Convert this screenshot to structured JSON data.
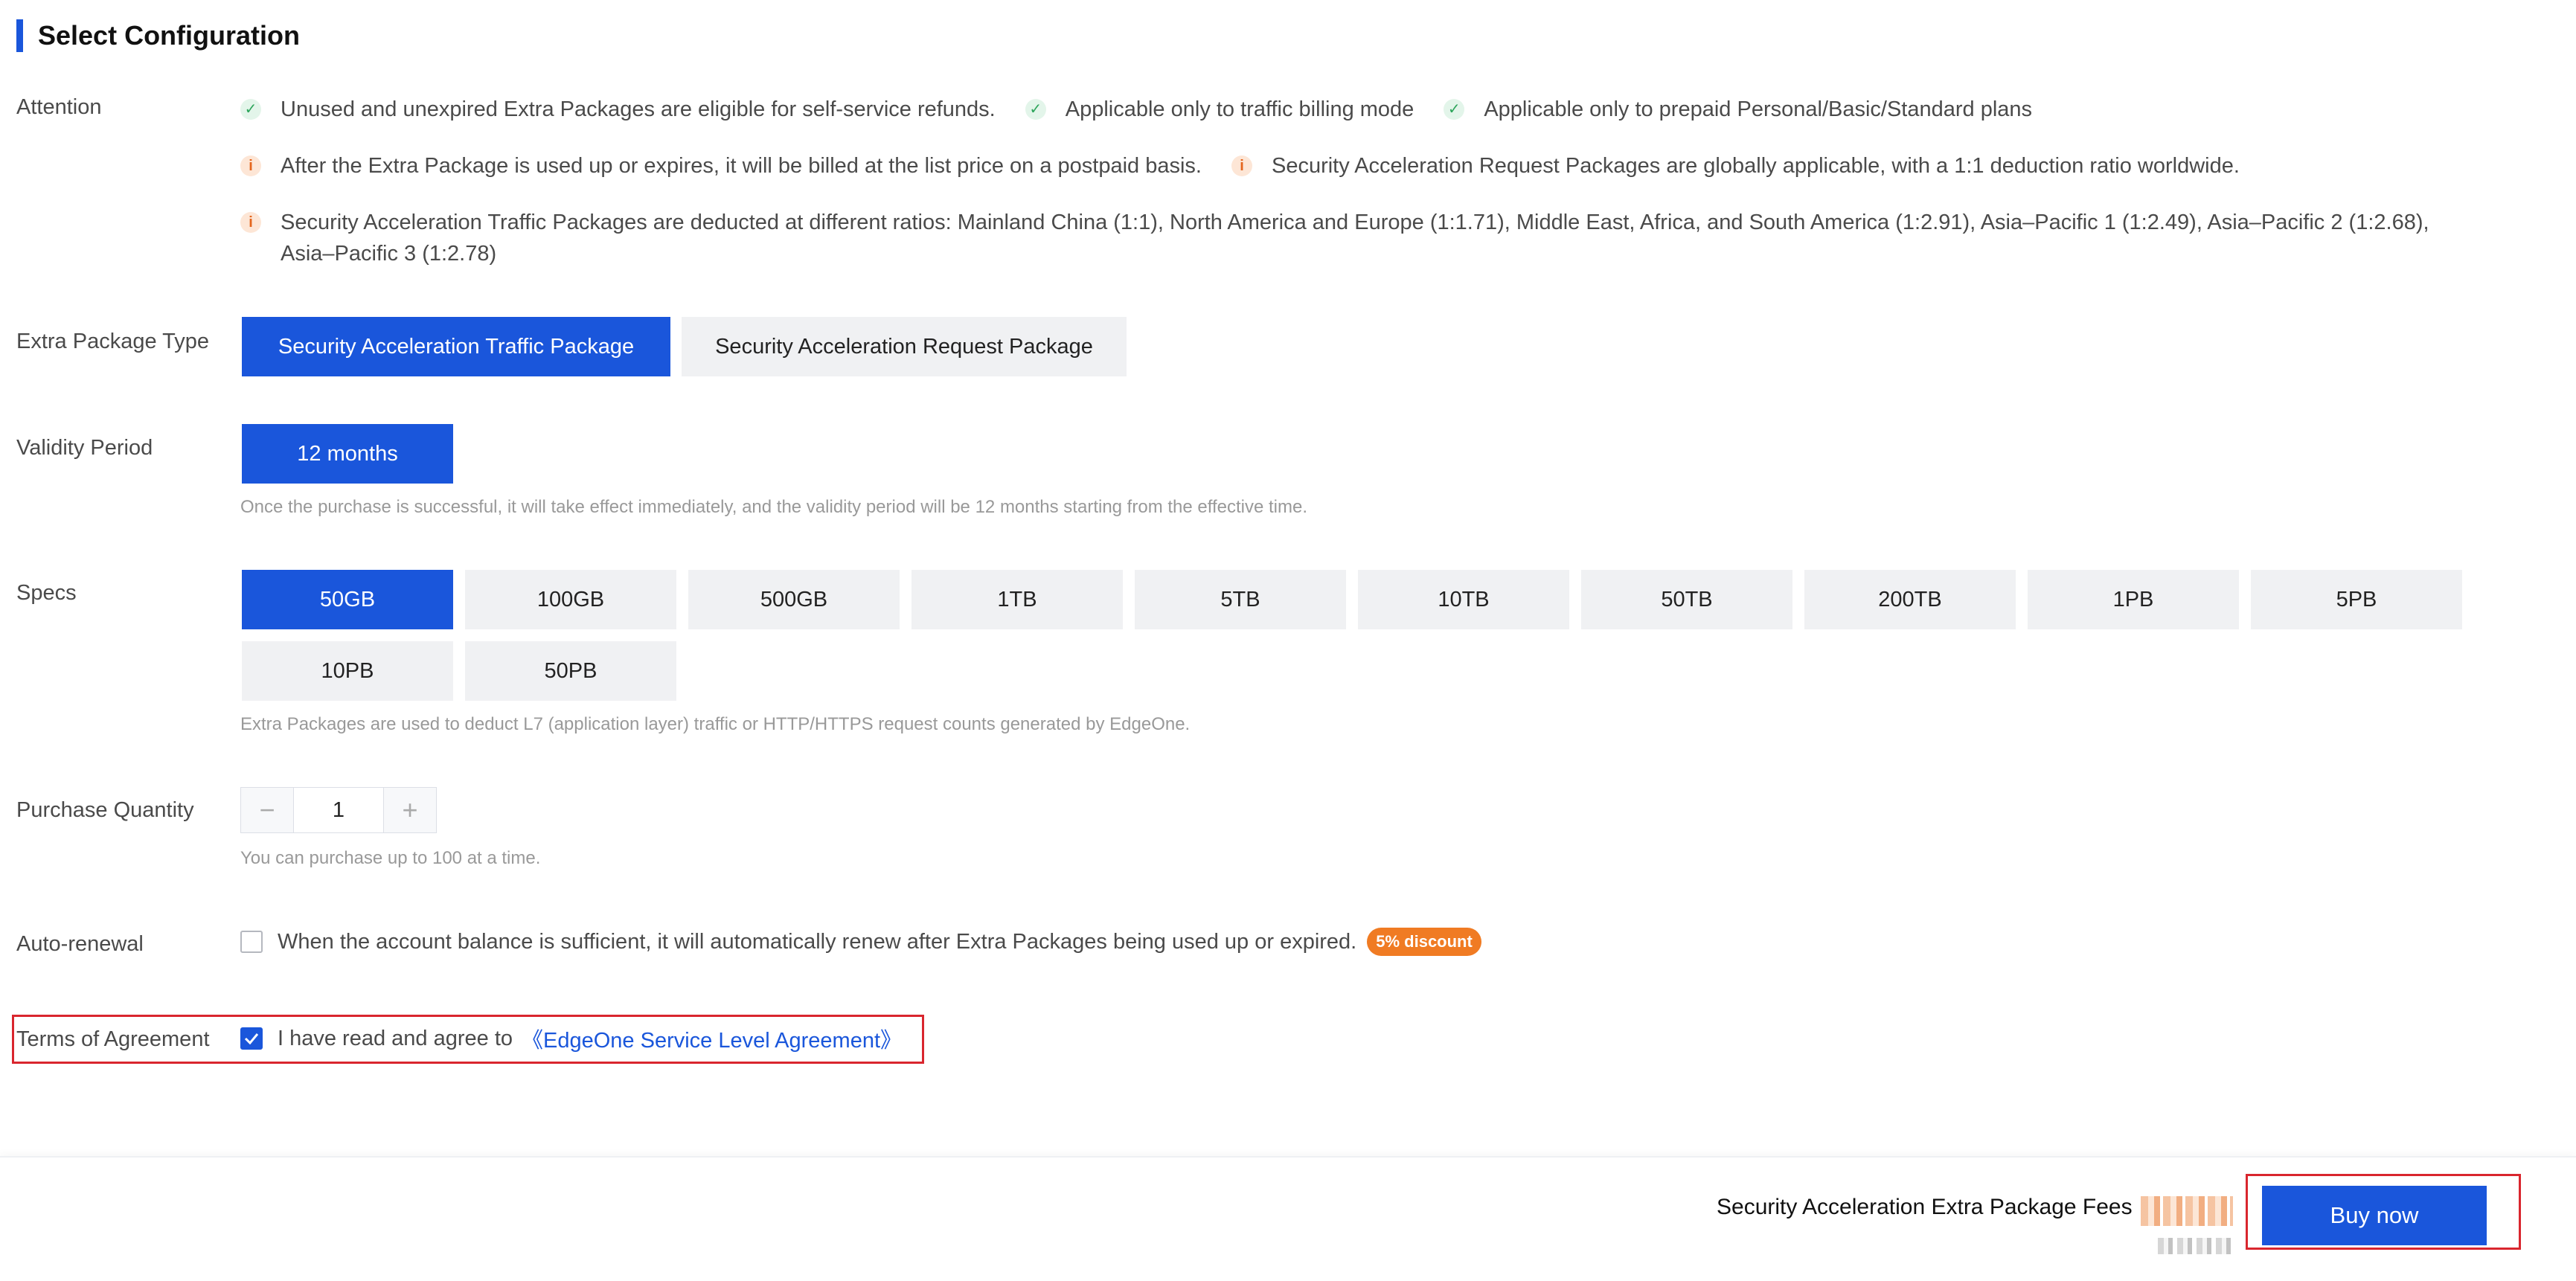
{
  "title": "Select Configuration",
  "attention": {
    "label": "Attention",
    "row1": [
      {
        "icon": "check-icon",
        "text": "Unused and unexpired Extra Packages are eligible for self-service refunds."
      },
      {
        "icon": "check-icon",
        "text": "Applicable only to traffic billing mode"
      },
      {
        "icon": "check-icon",
        "text": "Applicable only to prepaid Personal/Basic/Standard plans"
      }
    ],
    "row2": [
      {
        "icon": "info-icon",
        "text": "After the Extra Package is used up or expires, it will be billed at the list price on a postpaid basis."
      },
      {
        "icon": "info-icon",
        "text": "Security Acceleration Request Packages are globally applicable, with a 1:1 deduction ratio worldwide."
      }
    ],
    "row3": {
      "icon": "info-icon",
      "text": "Security Acceleration Traffic Packages are deducted at different ratios: Mainland China (1:1), North America and Europe (1:1.71), Middle East, Africa, and South America (1:2.91), Asia–Pacific 1 (1:2.49), Asia–Pacific 2 (1:2.68), Asia–Pacific 3 (1:2.78)"
    }
  },
  "package_type": {
    "label": "Extra Package Type",
    "options": [
      "Security Acceleration Traffic Package",
      "Security Acceleration Request Package"
    ],
    "selected": "Security Acceleration Traffic Package"
  },
  "validity": {
    "label": "Validity Period",
    "options": [
      "12 months"
    ],
    "selected": "12 months",
    "hint": "Once the purchase is successful, it will take effect immediately, and the validity period will be 12 months starting from the effective time."
  },
  "specs": {
    "label": "Specs",
    "options": [
      "50GB",
      "100GB",
      "500GB",
      "1TB",
      "5TB",
      "10TB",
      "50TB",
      "200TB",
      "1PB",
      "5PB",
      "10PB",
      "50PB"
    ],
    "selected": "50GB",
    "hint": "Extra Packages are used to deduct L7 (application layer) traffic or HTTP/HTTPS request counts generated by EdgeOne."
  },
  "quantity": {
    "label": "Purchase Quantity",
    "value": "1",
    "minus": "−",
    "plus": "+",
    "hint": "You can purchase up to 100 at a time."
  },
  "auto_renewal": {
    "label": "Auto-renewal",
    "checked": false,
    "text": "When the account balance is sufficient, it will automatically renew after Extra Packages being used up or expired.",
    "badge": "5% discount"
  },
  "terms": {
    "label": "Terms of Agreement",
    "checked": true,
    "text": "I have read and agree to",
    "link": "《EdgeOne Service Level Agreement》"
  },
  "footer": {
    "fee_label": "Security Acceleration Extra Package Fees",
    "buy_label": "Buy now"
  },
  "colors": {
    "primary": "#1a56db",
    "highlight": "#d9262e",
    "badge": "#f07b23"
  }
}
